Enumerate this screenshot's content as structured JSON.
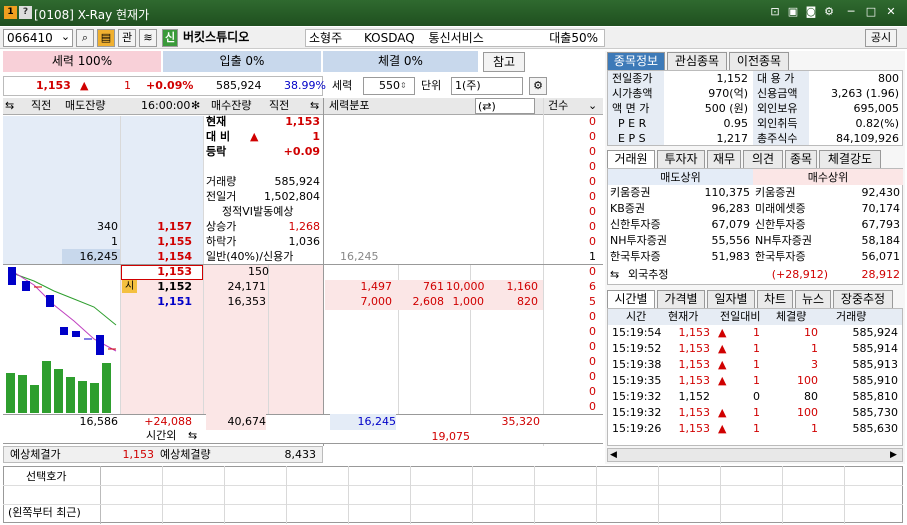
{
  "window": {
    "title": "[0108] X-Ray 현재가",
    "badge1": "1",
    "badge2": "?"
  },
  "toolbar": {
    "code": "066410",
    "kwan": "관",
    "shin": "신",
    "stock_name": "버킷스튜디오",
    "type": "소형주",
    "market": "KOSDAQ",
    "sector": "통신서비스",
    "loan": "대출50%",
    "notice": "공시"
  },
  "power_bar": {
    "seryuk": "세력 100%",
    "ipchul": "입출 0%",
    "chegyul": "체결 0%",
    "ref_button": "참고"
  },
  "price_line": {
    "price": "1,153",
    "arrow": "▲",
    "change": "1",
    "pct": "+0.09%",
    "volume": "585,924",
    "ratio": "38.99%",
    "seryuk_label": "세력",
    "seryuk_val": "550",
    "unit_label": "단위",
    "unit_val": "1(주)"
  },
  "orderbook_header": {
    "c1": "직전",
    "c2": "매도잔량",
    "time": "16:00:00",
    "c3": "매수잔량",
    "c4": "직전",
    "dist": "세력분포",
    "cnt": "건수"
  },
  "info": {
    "cur_l": "현재",
    "cur_v": "1,153",
    "diff_l": "대 비",
    "diff_arrow": "▲",
    "diff_v": "1",
    "rate_l": "등락",
    "rate_v": "+0.09",
    "vol_l": "거래량",
    "vol_v": "585,924",
    "prev_l": "전일거",
    "prev_v": "1,502,804",
    "vi": "정적VI발동예상",
    "up_l": "상승가",
    "up_v": "1,268",
    "down_l": "하락가",
    "down_v": "1,036",
    "general": "일반(40%)/신용가"
  },
  "asks": [
    {
      "qty": "340",
      "price": "1,157"
    },
    {
      "qty": "1",
      "price": "1,155"
    },
    {
      "qty": "16,245",
      "price": "1,154"
    }
  ],
  "mid": [
    {
      "price": "1,153",
      "qty": "150"
    },
    {
      "tag": "시",
      "price": "1,152",
      "qty": "24,171"
    },
    {
      "price": "1,151",
      "qty": "16,353"
    }
  ],
  "dist_rows": [
    {
      "a": "16,245",
      "n": "1"
    },
    {
      "a": "1,497",
      "b": "761",
      "c": "10,000",
      "d": "1,160",
      "n": "6"
    },
    {
      "a": "7,000",
      "b": "2,608",
      "c": "1,000",
      "d": "820",
      "n": "5"
    }
  ],
  "zeros": [
    "0",
    "0",
    "0",
    "0",
    "0",
    "0",
    "0",
    "0",
    "0",
    "0",
    "0",
    "0",
    "0",
    "0",
    "0",
    "0",
    "0",
    "0"
  ],
  "totals": {
    "ask_total": "16,586",
    "diff": "+24,088",
    "bid_total": "40,674",
    "after": "시간외",
    "dist1": "16,245",
    "dist2": "35,320",
    "dist3": "19,075"
  },
  "expected": {
    "price_l": "예상체결가",
    "price_v": "1,153",
    "qty_l": "예상체결량",
    "qty_v": "8,433"
  },
  "bottom": {
    "l1": "선택호가",
    "l2": "(왼쪽부터 최근)"
  },
  "right_tabs1": [
    "종목정보",
    "관심종목",
    "이전종목"
  ],
  "stock_info": [
    {
      "l": "전일종가",
      "v": "1,152",
      "l2": "대 용 가",
      "v2": "800"
    },
    {
      "l": "시가총액",
      "v": "970(억)",
      "l2": "신용금액",
      "v2": "3,263 (1.96)"
    },
    {
      "l": "액 면 가",
      "v": "500 (원)",
      "l2": "외인보유",
      "v2": "695,005"
    },
    {
      "l": "P E R",
      "v": "0.95",
      "l2": "외인취득",
      "v2": "0.82(%)"
    },
    {
      "l": "E P S",
      "v": "1,217",
      "l2": "총주식수",
      "v2": "84,109,926"
    }
  ],
  "right_tabs2": [
    "거래원",
    "투자자",
    "재무",
    "의견",
    "종목",
    "체결강도"
  ],
  "brokers": {
    "sell_h": "매도상위",
    "buy_h": "매수상위",
    "rows": [
      {
        "s": "키움증권",
        "sv": "110,375",
        "b": "키움증권",
        "bv": "92,430"
      },
      {
        "s": "KB증권",
        "sv": "96,283",
        "b": "미래에셋증",
        "bv": "70,174"
      },
      {
        "s": "신한투자증",
        "sv": "67,079",
        "b": "신한투자증",
        "bv": "67,793"
      },
      {
        "s": "NH투자증권",
        "sv": "55,556",
        "b": "NH투자증권",
        "bv": "58,184"
      },
      {
        "s": "한국투자증",
        "sv": "51,983",
        "b": "한국투자증",
        "bv": "56,071"
      }
    ],
    "foreign_l": "외국추정",
    "foreign_s": "",
    "foreign_sv": "(+28,912)",
    "foreign_bv": "28,912"
  },
  "right_tabs3": [
    "시간별",
    "가격별",
    "일자별",
    "차트",
    "뉴스",
    "장중추정"
  ],
  "ticks_header": [
    "시간",
    "현재가",
    "전일대비",
    "체결량",
    "거래량"
  ],
  "ticks": [
    {
      "t": "15:19:54",
      "p": "1,153",
      "a": "▲",
      "d": "1",
      "q": "10",
      "v": "585,924",
      "red": true
    },
    {
      "t": "15:19:52",
      "p": "1,153",
      "a": "▲",
      "d": "1",
      "q": "1",
      "v": "585,914",
      "red": true
    },
    {
      "t": "15:19:38",
      "p": "1,153",
      "a": "▲",
      "d": "1",
      "q": "3",
      "v": "585,913",
      "red": true
    },
    {
      "t": "15:19:35",
      "p": "1,153",
      "a": "▲",
      "d": "1",
      "q": "100",
      "v": "585,910",
      "red": true
    },
    {
      "t": "15:19:32",
      "p": "1,152",
      "a": "",
      "d": "0",
      "q": "80",
      "v": "585,810",
      "red": false
    },
    {
      "t": "15:19:32",
      "p": "1,153",
      "a": "▲",
      "d": "1",
      "q": "100",
      "v": "585,730",
      "red": true
    },
    {
      "t": "15:19:26",
      "p": "1,153",
      "a": "▲",
      "d": "1",
      "q": "1",
      "v": "585,630",
      "red": true
    }
  ],
  "colors": {
    "title_bg": "#2f6a2f",
    "ask_bg": "#e4ecf7",
    "bid_bg": "#fbe6e6",
    "up": "#d00000",
    "down": "#0000c8",
    "bar_green": "#2e9e2e"
  }
}
